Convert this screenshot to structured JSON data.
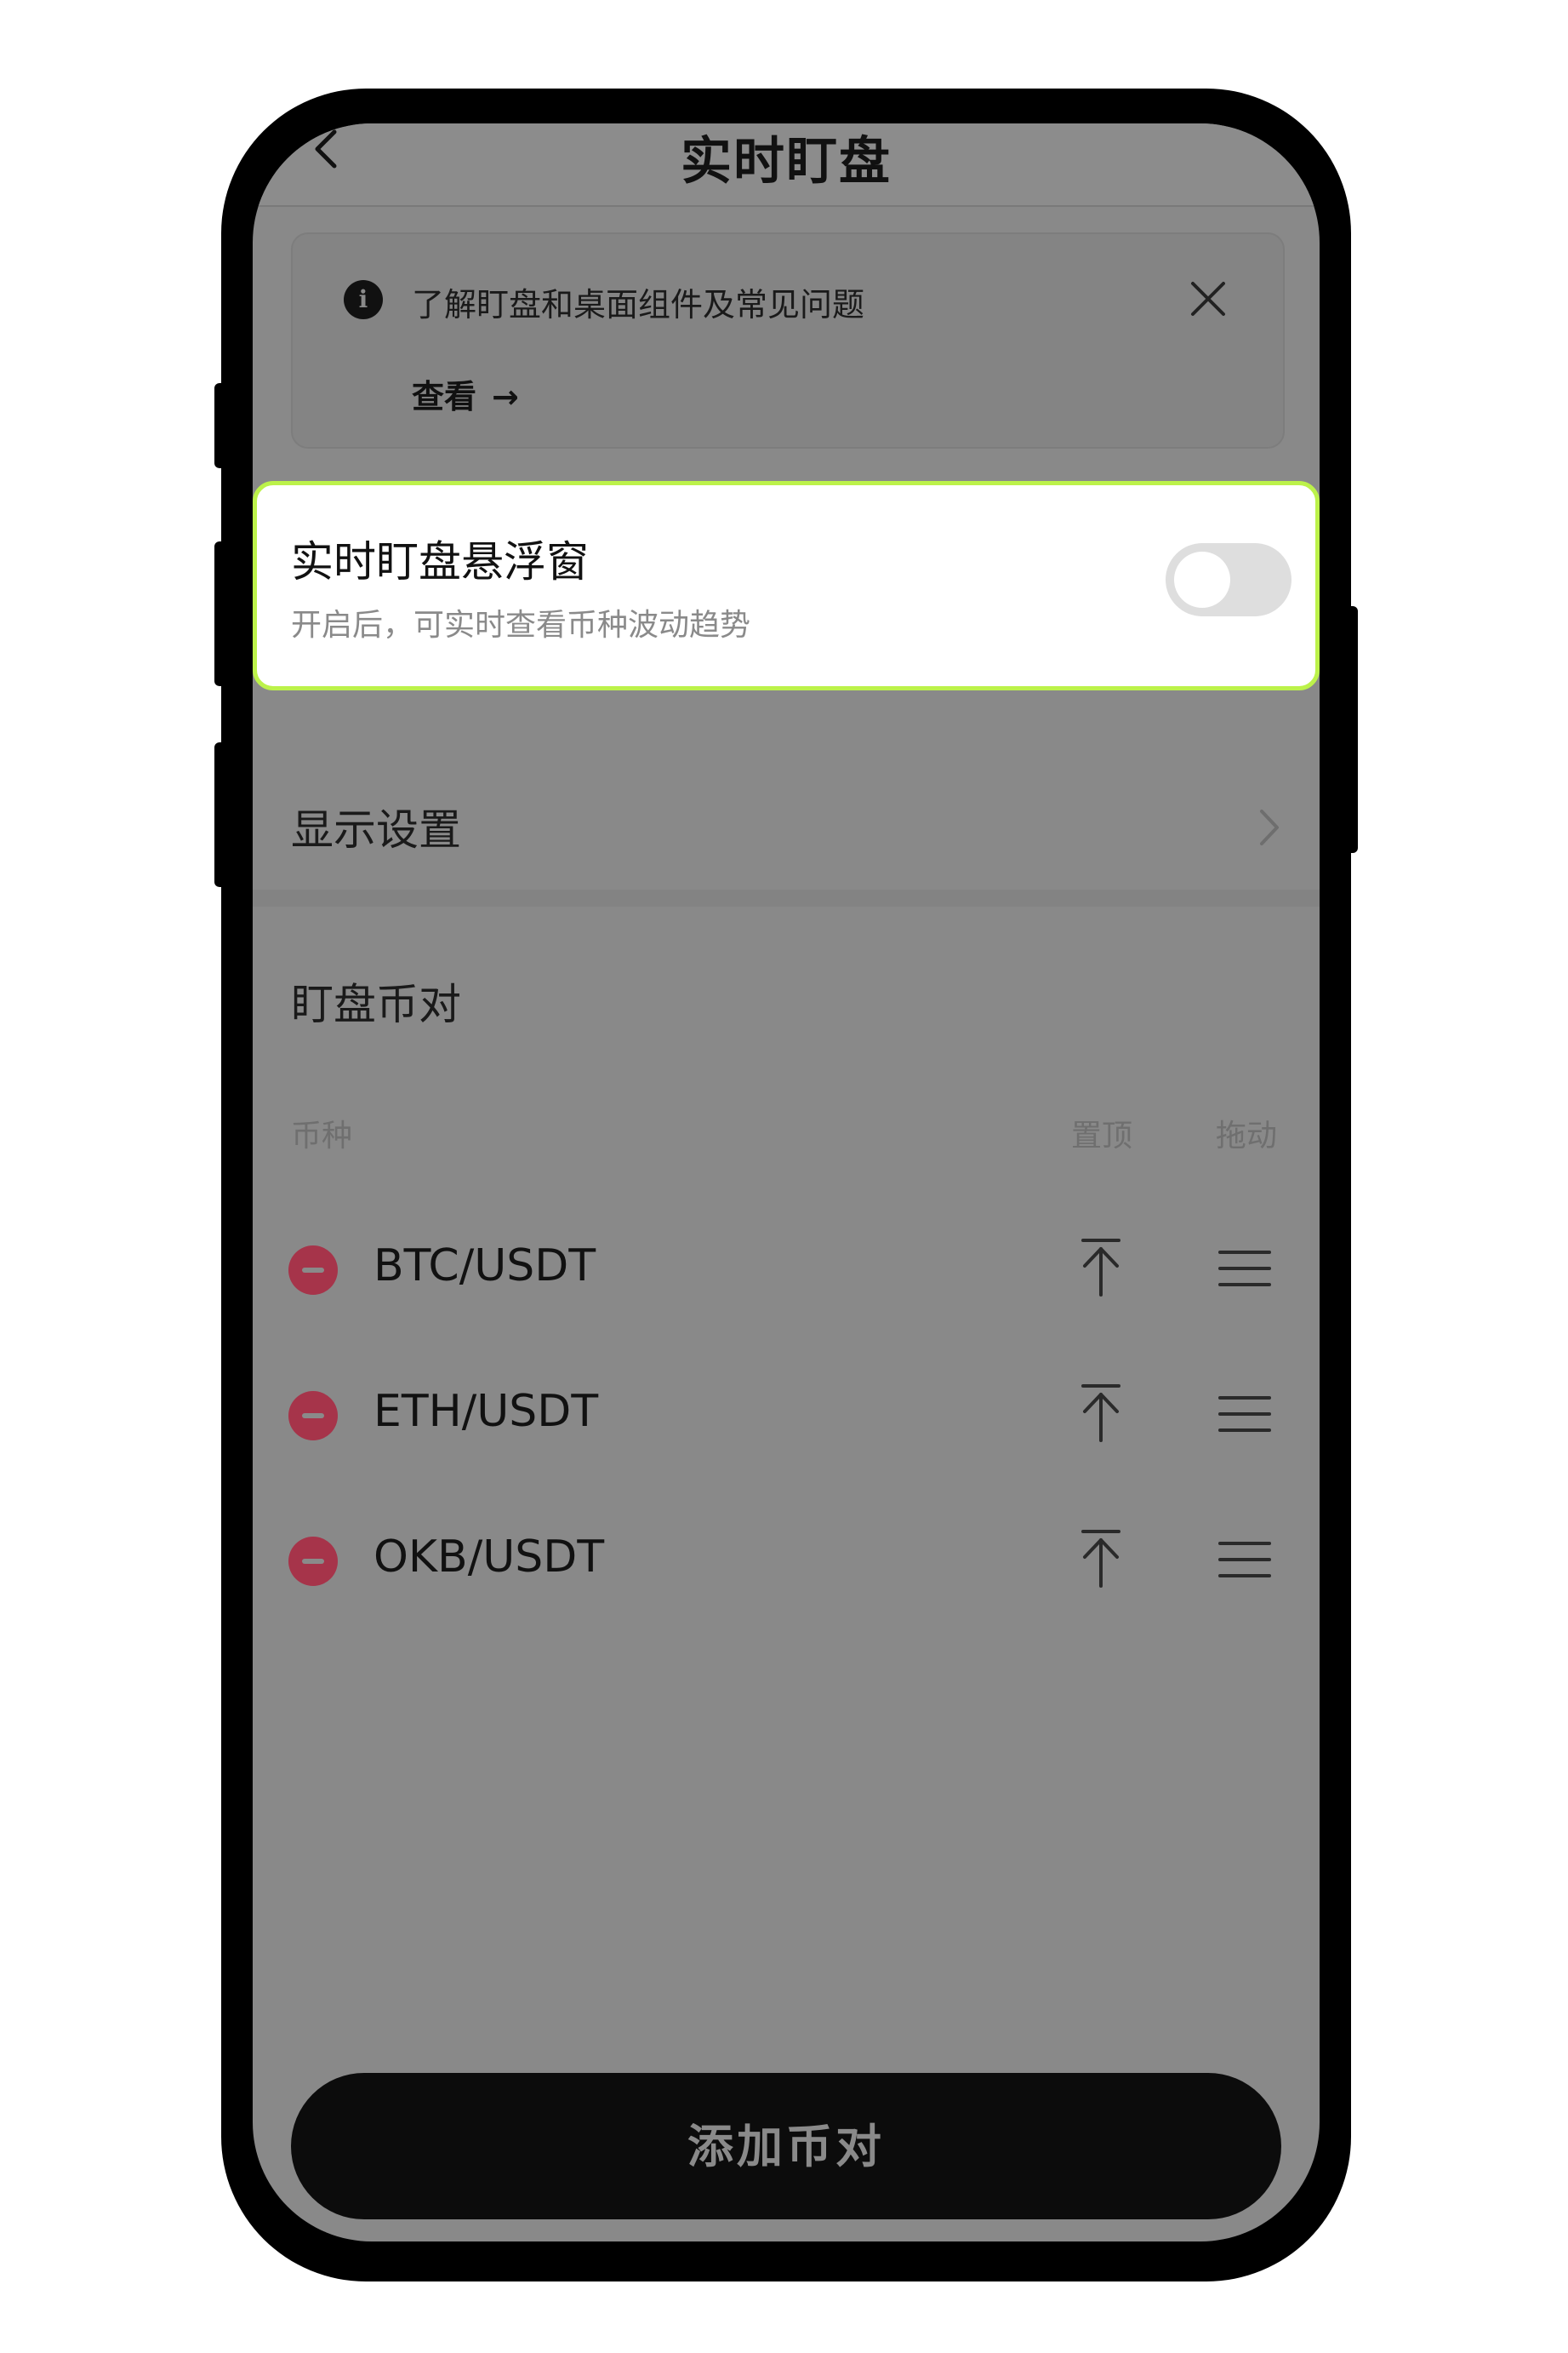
{
  "nav": {
    "title": "实时盯盘"
  },
  "notice": {
    "text": "了解盯盘和桌面组件及常见问题",
    "link_label": "查看",
    "link_arrow": "→",
    "info_glyph": "i"
  },
  "floating_window": {
    "title": "实时盯盘悬浮窗",
    "subtitle": "开启后，可实时查看币种波动趋势",
    "enabled": false
  },
  "display_settings": {
    "label": "显示设置"
  },
  "watchlist": {
    "title": "盯盘币对",
    "columns": {
      "coin": "币种",
      "pin": "置顶",
      "drag": "拖动"
    },
    "pairs": [
      "BTC/USDT",
      "ETH/USDT",
      "OKB/USDT"
    ]
  },
  "add_button": {
    "label": "添加币对"
  },
  "colors": {
    "toggle_highlight": "#bcf24a",
    "remove_red": "#a6344a",
    "button_bg": "#0c0c0c"
  },
  "icons": [
    "back-arrow-icon",
    "info-icon",
    "close-icon",
    "chevron-right-icon",
    "remove-icon",
    "pin-to-top-icon",
    "drag-handle-icon"
  ]
}
